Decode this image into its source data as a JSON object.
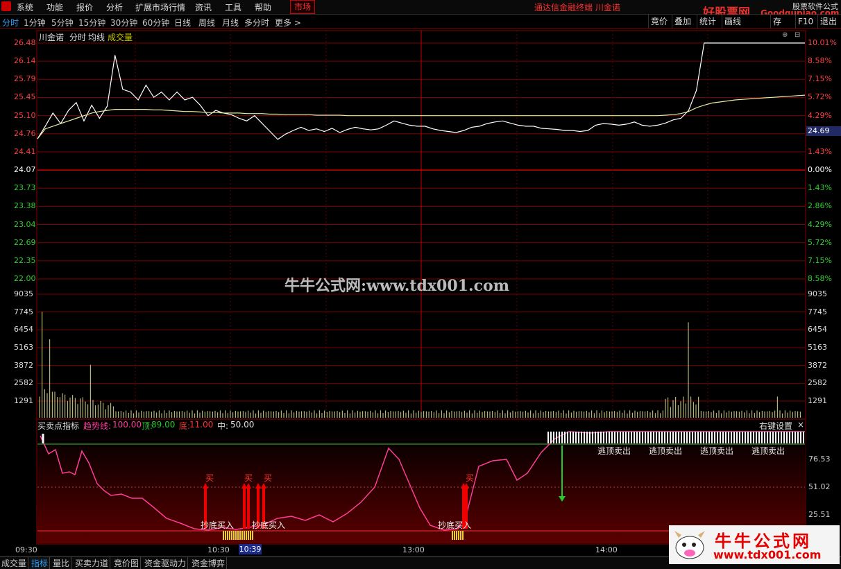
{
  "menu": [
    "系统",
    "功能",
    "报价",
    "分析",
    "扩展市场行情",
    "资讯",
    "工具",
    "帮助"
  ],
  "market_button": "市场",
  "terminal_title": "通达信金融终端  川金诺",
  "brand": {
    "main": "好股票网",
    "url": "Goodgupiao.com",
    "corner": "股票软件公式"
  },
  "periods": [
    "分时",
    "1分钟",
    "5分钟",
    "15分钟",
    "30分钟",
    "60分钟",
    "日线",
    "周线",
    "月线",
    "多分时",
    "更多 >"
  ],
  "right_buttons": [
    "竞价",
    "叠加",
    "统计",
    "画线",
    "存",
    "F10",
    "退出"
  ],
  "chart_header": {
    "name": "川金诺",
    "mode": "分时",
    "avg": "均线",
    "vol": "成交量"
  },
  "watermark": "牛牛公式网:www.tdx001.com",
  "price_axis_left": [
    "26.48",
    "26.14",
    "25.79",
    "25.45",
    "25.10",
    "24.76",
    "24.41",
    "24.07",
    "23.73",
    "23.38",
    "23.04",
    "22.69",
    "22.35",
    "22.00"
  ],
  "price_axis_right": [
    "10.01%",
    "8.58%",
    "7.15%",
    "5.72%",
    "4.29%",
    "2.86%",
    "1.43%",
    "0.00%",
    "1.43%",
    "2.86%",
    "4.29%",
    "5.72%",
    "7.15%",
    "8.58%"
  ],
  "current_price_tag": "24.69",
  "vol_axis": [
    "9035",
    "7745",
    "6454",
    "5163",
    "3872",
    "2582",
    "1291"
  ],
  "indicator": {
    "name": "买卖点指标",
    "trend_label": "趋势线:",
    "trend_value": "100.00",
    "top_label": "顶:",
    "top_value": "89.00",
    "bottom_label": "底:",
    "bottom_value": "11.00",
    "mid_label": "中:",
    "mid_value": "50.00",
    "settings": "右键设置",
    "close": "×",
    "right_axis": [
      "76.53",
      "51.02",
      "25.51"
    ],
    "buy_label": "买",
    "bottom_buy": "抄底买入",
    "top_sell": "逃顶卖出"
  },
  "time_axis": [
    "09:30",
    "10:30",
    "13:00",
    "14:00"
  ],
  "time_cursor": "10:39",
  "bottom_tabs": [
    "成交量",
    "指标",
    "量比",
    "买卖力道",
    "竞价图",
    "资金驱动力",
    "资金博弈"
  ],
  "badge": {
    "title": "牛牛公式网",
    "url": "www.tdx001.com"
  },
  "chart_data": {
    "type": "line",
    "title": "川金诺",
    "prev_close": 24.07,
    "ylim": [
      22.0,
      26.48
    ],
    "x_time_labels": [
      "09:30",
      "10:30",
      "13:00",
      "14:00"
    ],
    "series": [
      {
        "name": "分时",
        "values": [
          24.66,
          24.9,
          25.15,
          24.95,
          25.2,
          25.35,
          25.0,
          25.3,
          25.05,
          25.28,
          26.25,
          25.6,
          25.55,
          25.4,
          25.68,
          25.45,
          25.55,
          25.4,
          25.55,
          25.4,
          25.45,
          25.3,
          25.1,
          25.2,
          25.15,
          25.12,
          25.05,
          25.0,
          25.1,
          24.95,
          24.8,
          24.65,
          24.75,
          24.82,
          24.88,
          24.82,
          24.85,
          24.8,
          24.86,
          24.78,
          24.84,
          24.88,
          24.85,
          24.83,
          24.85,
          24.92,
          25.0,
          24.96,
          24.92,
          24.9,
          24.9,
          24.85,
          24.82,
          24.8,
          24.78,
          24.82,
          24.88,
          24.9,
          24.95,
          24.98,
          25.0,
          24.96,
          24.92,
          24.9,
          24.9,
          24.86,
          24.85,
          24.84,
          24.82,
          24.82,
          24.8,
          24.82,
          24.92,
          24.95,
          24.94,
          24.92,
          24.94,
          24.98,
          24.92,
          24.9,
          24.92,
          24.96,
          25.02,
          25.05,
          25.2,
          25.58,
          26.48,
          26.48,
          26.48,
          26.48,
          26.48,
          26.48,
          26.48,
          26.48,
          26.48,
          26.48,
          26.48,
          26.48,
          26.48,
          26.48
        ]
      },
      {
        "name": "均线",
        "values": [
          24.66,
          24.85,
          24.9,
          24.95,
          25.0,
          25.05,
          25.1,
          25.15,
          25.18,
          25.2,
          25.22,
          25.22,
          25.22,
          25.22,
          25.22,
          25.21,
          25.21,
          25.2,
          25.19,
          25.18,
          25.18,
          25.17,
          25.16,
          25.16,
          25.15,
          25.15,
          25.15,
          25.14,
          25.14,
          25.14,
          25.13,
          25.13,
          25.12,
          25.12,
          25.12,
          25.12,
          25.11,
          25.11,
          25.11,
          25.11,
          25.1,
          25.1,
          25.1,
          25.1,
          25.1,
          25.1,
          25.1,
          25.1,
          25.1,
          25.1,
          25.1,
          25.1,
          25.1,
          25.1,
          25.1,
          25.1,
          25.1,
          25.1,
          25.1,
          25.1,
          25.1,
          25.1,
          25.1,
          25.1,
          25.1,
          25.1,
          25.1,
          25.1,
          25.1,
          25.1,
          25.1,
          25.1,
          25.1,
          25.1,
          25.1,
          25.1,
          25.1,
          25.1,
          25.1,
          25.1,
          25.1,
          25.11,
          25.12,
          25.14,
          25.18,
          25.25,
          25.3,
          25.34,
          25.36,
          25.38,
          25.4,
          25.41,
          25.42,
          25.43,
          25.44,
          25.45,
          25.46,
          25.47,
          25.48,
          25.49
        ]
      }
    ]
  }
}
